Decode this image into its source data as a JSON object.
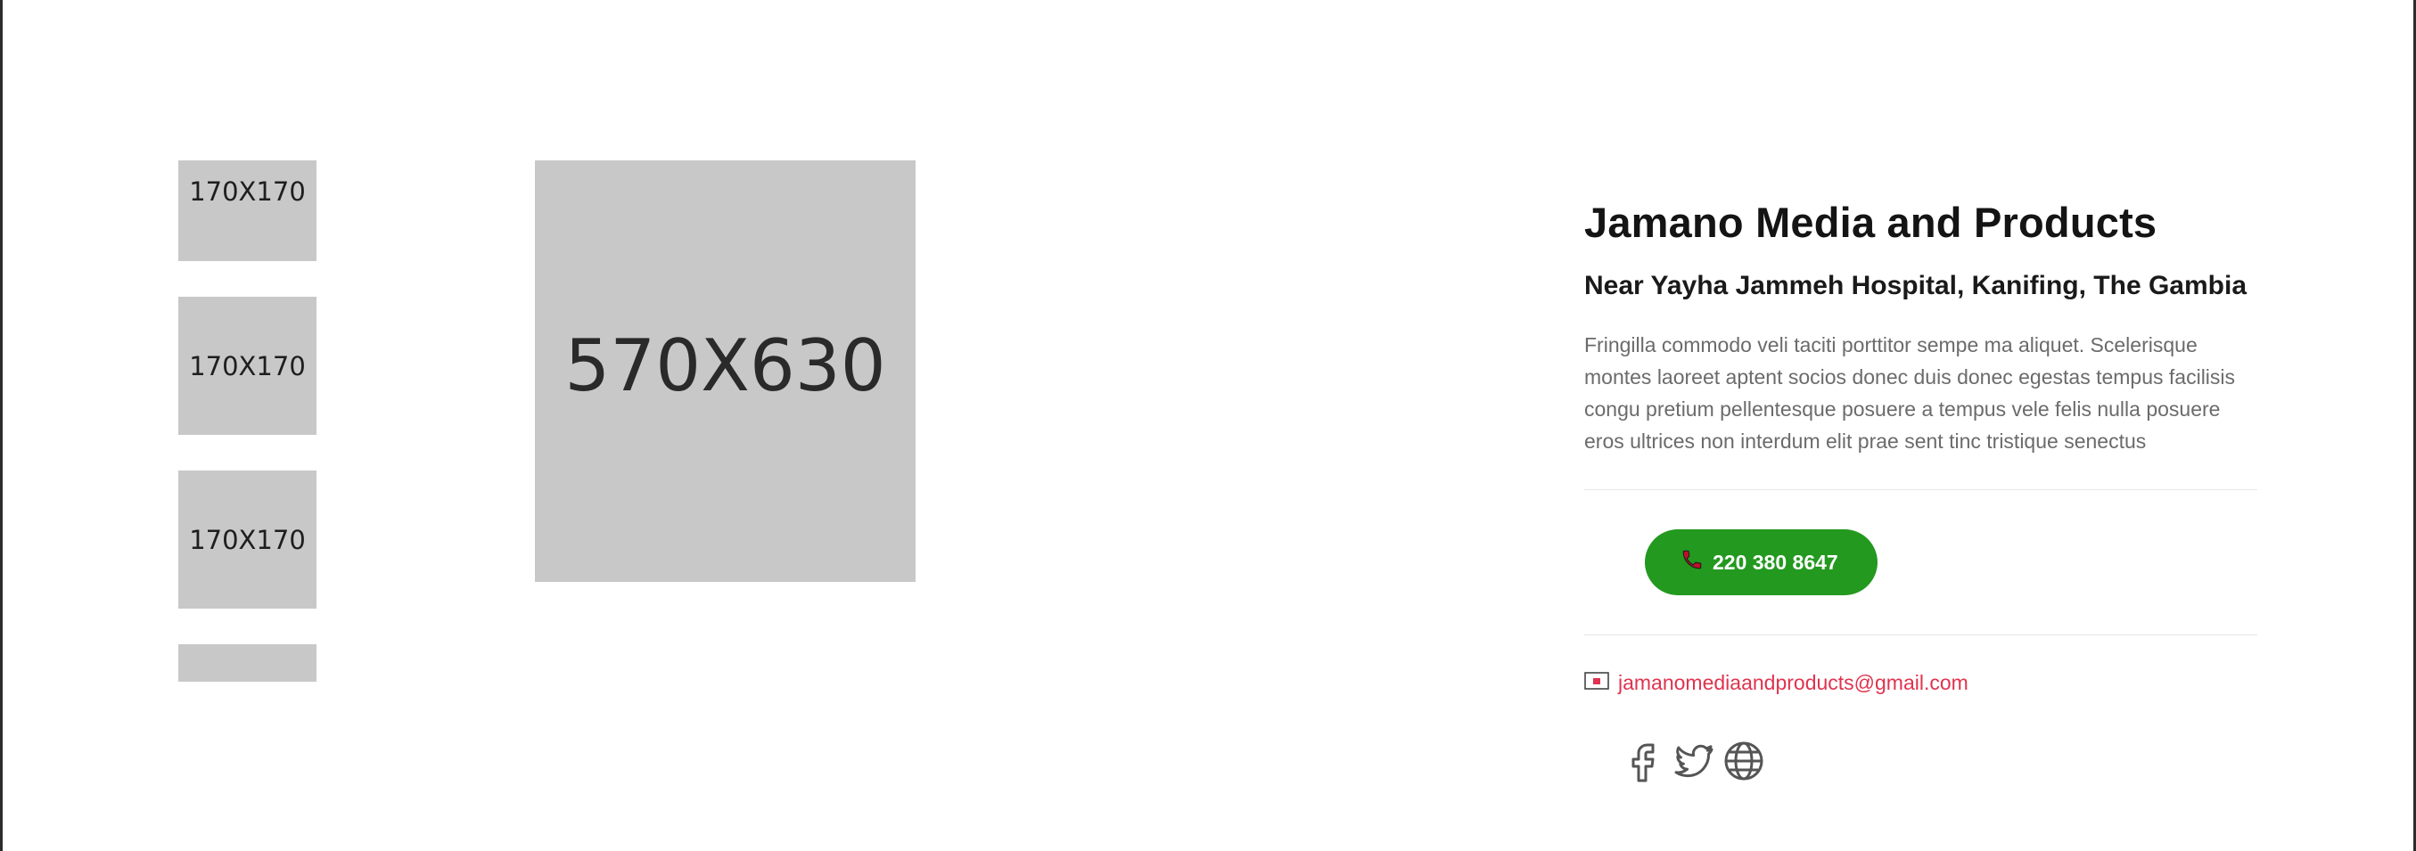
{
  "gallery": {
    "thumbnails": [
      {
        "label": "170X170"
      },
      {
        "label": "170X170"
      },
      {
        "label": "170X170"
      },
      {
        "label": ""
      }
    ],
    "main_image": {
      "label": "570X630"
    }
  },
  "business": {
    "name": "Jamano Media and Products",
    "address": "Near Yayha Jammeh Hospital, Kanifing, The Gambia",
    "description": "Fringilla commodo veli taciti porttitor sempe ma aliquet. Scelerisque montes laoreet aptent socios donec duis donec egestas tempus facilisis congu pretium pellentesque posuere a tempus vele felis nulla posuere eros ultrices non interdum elit prae sent tinc tristique senectus",
    "phone": "220 380 8647",
    "email": "jamanomediaandproducts@gmail.com"
  },
  "social": [
    {
      "icon": "facebook-icon"
    },
    {
      "icon": "twitter-icon"
    },
    {
      "icon": "globe-icon"
    }
  ],
  "colors": {
    "call_button": "#23991f",
    "email_link": "#e0334f",
    "placeholder_bg": "#c8c8c8"
  }
}
